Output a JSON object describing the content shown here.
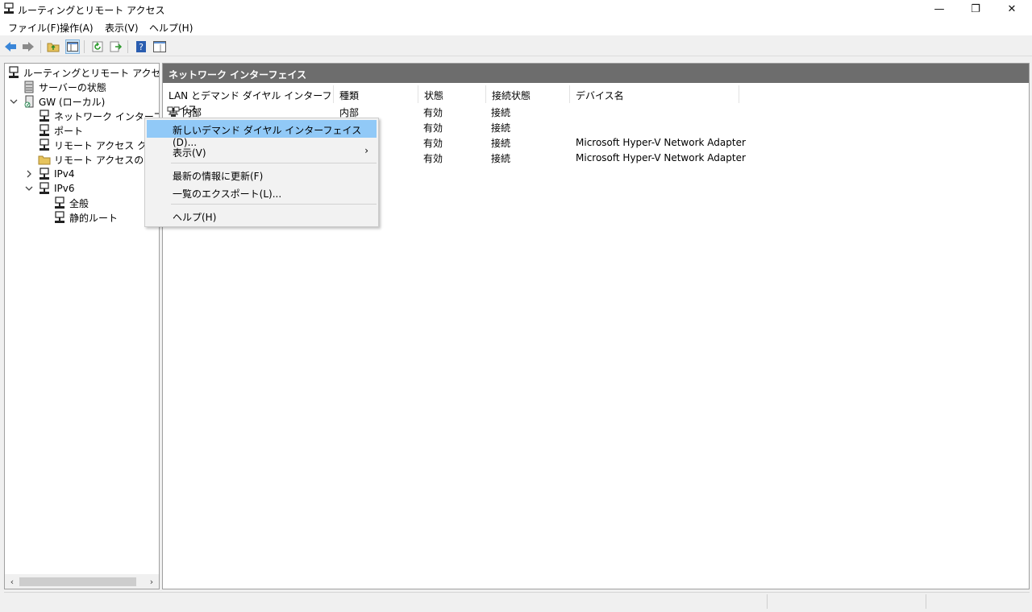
{
  "window": {
    "title": "ルーティングとリモート アクセス",
    "minimize": "—",
    "restore": "❐",
    "close": "✕"
  },
  "menu": [
    "ファイル(F)",
    "操作(A)",
    "表示(V)",
    "ヘルプ(H)"
  ],
  "tree": {
    "root": "ルーティングとリモート アクセス",
    "items": [
      {
        "label": "サーバーの状態"
      },
      {
        "label": "GW (ローカル)"
      },
      {
        "label": "ネットワーク インターフェイス"
      },
      {
        "label": "ポート"
      },
      {
        "label": "リモート アクセス クライア"
      },
      {
        "label": "リモート アクセスのログと"
      },
      {
        "label": "IPv4"
      },
      {
        "label": "IPv6"
      },
      {
        "label": "全般"
      },
      {
        "label": "静的ルート"
      }
    ]
  },
  "content": {
    "header": "ネットワーク インターフェイス",
    "columns": [
      "LAN とデマンド ダイヤル インターフェイス",
      "種類",
      "状態",
      "接続状態",
      "デバイス名"
    ],
    "rows": [
      [
        "内部",
        "内部",
        "有効",
        "接続",
        ""
      ],
      [
        "",
        "",
        "有効",
        "接続",
        ""
      ],
      [
        "",
        "",
        "有効",
        "接続",
        "Microsoft Hyper-V Network Adapter"
      ],
      [
        "",
        "",
        "有効",
        "接続",
        "Microsoft Hyper-V Network Adapter"
      ]
    ]
  },
  "context_menu": {
    "items": [
      {
        "label": "新しいデマンド ダイヤル インターフェイス(D)...",
        "highlight": true
      },
      {
        "label": "表示(V)",
        "submenu": true
      },
      {
        "label": "最新の情報に更新(F)"
      },
      {
        "label": "一覧のエクスポート(L)..."
      },
      {
        "label": "ヘルプ(H)"
      }
    ],
    "submenu_arrow": "›"
  },
  "scroll": {
    "left": "‹",
    "right": "›"
  },
  "icons": {
    "back": "back-arrow-icon",
    "forward": "forward-arrow-icon",
    "up": "up-folder-icon",
    "show_hide": "show-hide-tree-icon",
    "refresh": "refresh-icon",
    "export": "export-list-icon",
    "help": "help-icon",
    "properties": "properties-icon"
  },
  "colors": {
    "header_bg": "#6d6d6d",
    "menu_highlight": "#91c9f7",
    "nav_arrow": "#3a86d8"
  }
}
